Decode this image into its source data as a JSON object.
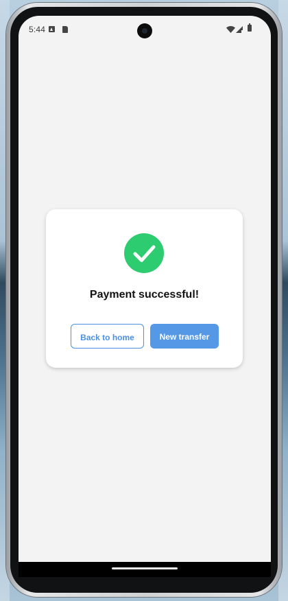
{
  "status_bar": {
    "time": "5:44",
    "left_icons": [
      "a-notification-icon",
      "sd-card-icon"
    ],
    "right_icons": [
      "wifi-icon",
      "cellular-signal-icon",
      "battery-icon"
    ]
  },
  "card": {
    "icon": "check-circle-icon",
    "title": "Payment successful!",
    "back_button_label": "Back to home",
    "new_transfer_button_label": "New transfer"
  },
  "colors": {
    "success": "#2ECC71",
    "primary": "#5599E6",
    "outline": "#4A90E2",
    "screen_background": "#F3F3F3"
  }
}
